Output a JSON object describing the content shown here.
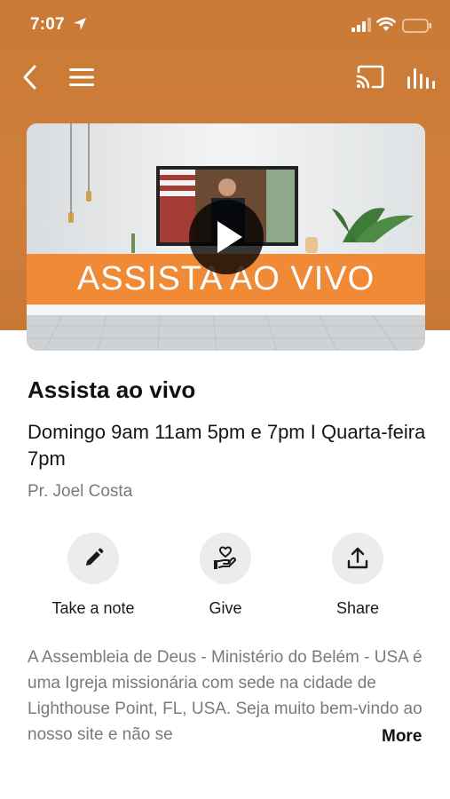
{
  "status_bar": {
    "time": "7:07",
    "icons": [
      "location-arrow-icon",
      "cellular-signal-icon",
      "wifi-icon",
      "battery-icon"
    ]
  },
  "nav": {
    "icons": [
      "back-chevron-icon",
      "hamburger-menu-icon",
      "cast-icon",
      "audio-bars-icon"
    ]
  },
  "video": {
    "banner_text": "ASSISTA AO VIVO",
    "banner_color": "#f08a36",
    "play_icon": "play-icon"
  },
  "content": {
    "title": "Assista ao vivo",
    "subtitle": "Domingo 9am 11am 5pm e 7pm I Quarta-feira 7pm",
    "author": "Pr. Joel Costa"
  },
  "actions": [
    {
      "label": "Take a note",
      "icon": "pencil-icon"
    },
    {
      "label": "Give",
      "icon": "hand-heart-icon"
    },
    {
      "label": "Share",
      "icon": "share-upload-icon"
    }
  ],
  "description": {
    "text": "A Assembleia de Deus - Ministério do Belém - USA é uma Igreja missionária com sede na cidade de Lighthouse Point, FL, USA. Seja muito bem-vindo ao nosso site e não se",
    "more_label": "More"
  },
  "colors": {
    "header": "#cf7f3a",
    "accent": "#f08a36"
  }
}
